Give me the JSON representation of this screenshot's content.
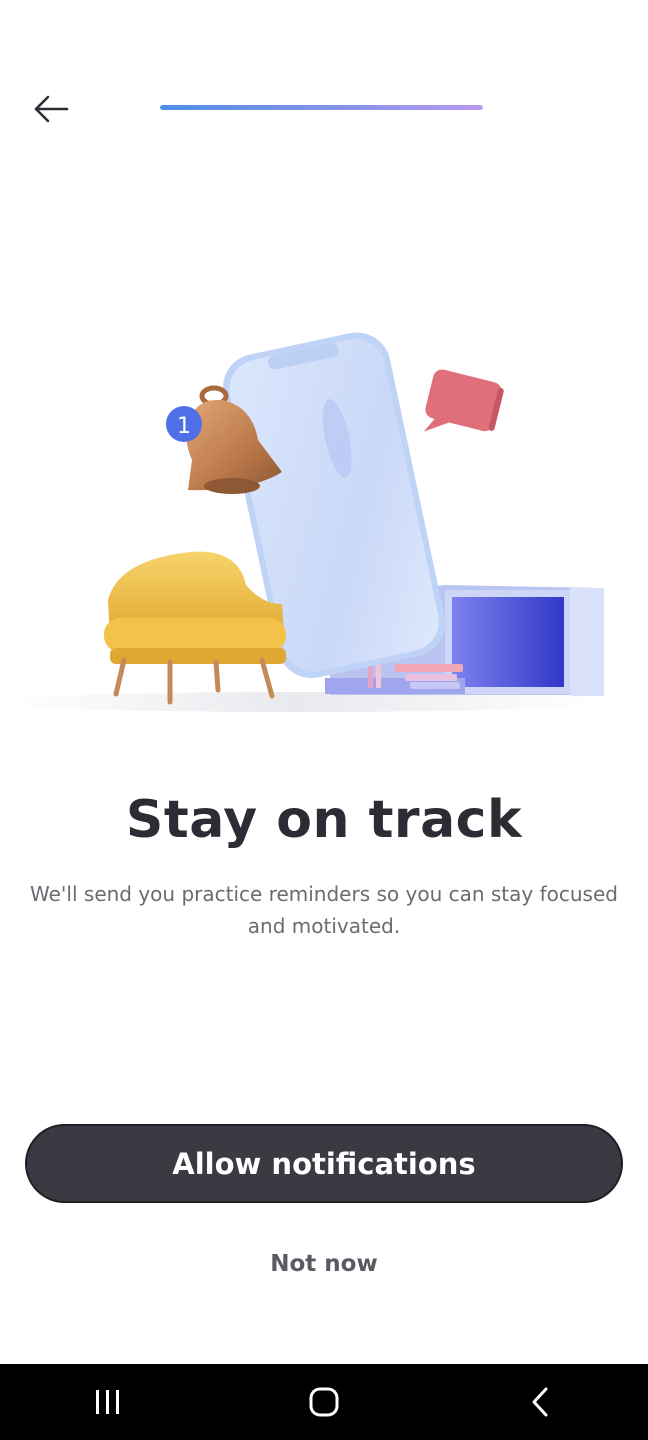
{
  "header": {
    "back_icon": "arrow-left-icon",
    "progress": {
      "percent": 100,
      "gradient": [
        "#4f8fe8",
        "#b89af0"
      ]
    }
  },
  "illustration": {
    "badge_count": "1",
    "colors": {
      "phone": "#cfe0fb",
      "bell": "#c98a55",
      "chair": "#f1c24a",
      "bubble": "#e06f7c",
      "shelf": "#4a4fe0",
      "badge": "#4f6fe6"
    }
  },
  "content": {
    "title": "Stay on track",
    "subtitle": "We'll send you practice reminders so you can stay focused and motivated."
  },
  "actions": {
    "primary_label": "Allow notifications",
    "secondary_label": "Not now"
  },
  "system_nav": {
    "recents_icon": "recents-icon",
    "home_icon": "home-icon",
    "back_icon": "back-chevron-icon"
  }
}
